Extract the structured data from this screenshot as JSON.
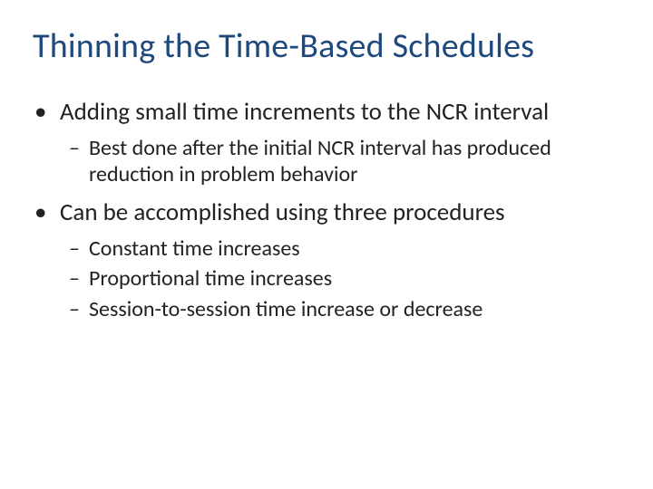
{
  "title": "Thinning the Time-Based Schedules",
  "bullets": [
    {
      "text": "Adding small time increments to the NCR interval",
      "sub": [
        "Best done after the initial NCR interval has produced reduction in problem behavior"
      ]
    },
    {
      "text": "Can be accomplished using three procedures",
      "sub": [
        "Constant time increases",
        "Proportional time increases",
        "Session-to-session time increase or decrease"
      ]
    }
  ],
  "bullet_glyph_l1": "•",
  "bullet_glyph_l2": "–"
}
